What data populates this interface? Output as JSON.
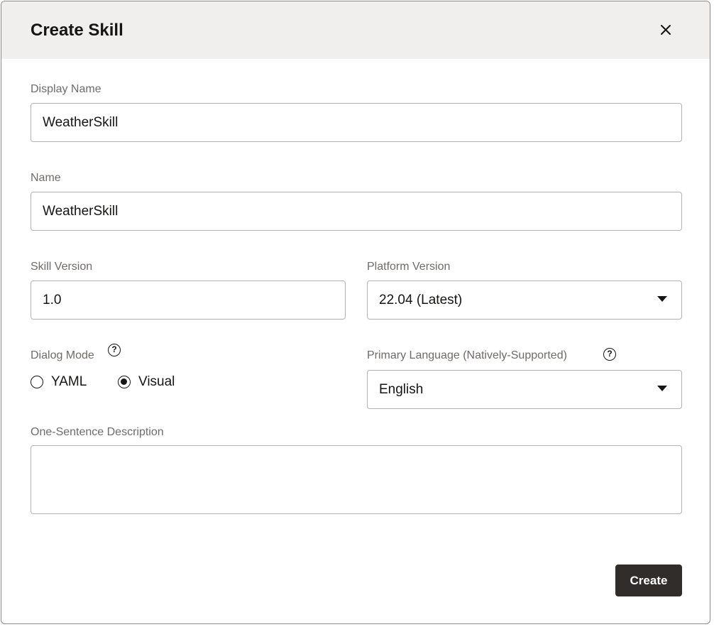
{
  "dialog": {
    "title": "Create Skill",
    "close_icon": "close-icon"
  },
  "form": {
    "display_name": {
      "label": "Display Name",
      "value": "WeatherSkill"
    },
    "name": {
      "label": "Name",
      "value": "WeatherSkill"
    },
    "skill_version": {
      "label": "Skill Version",
      "value": "1.0"
    },
    "platform_version": {
      "label": "Platform Version",
      "selected": "22.04 (Latest)",
      "icon": "chevron-down-icon"
    },
    "dialog_mode": {
      "label": "Dialog Mode",
      "help_icon": "help-icon",
      "options": [
        {
          "label": "YAML",
          "checked": false
        },
        {
          "label": "Visual",
          "checked": true
        }
      ]
    },
    "primary_language": {
      "label": "Primary Language (Natively-Supported)",
      "help_icon": "help-icon",
      "selected": "English",
      "icon": "chevron-down-icon"
    },
    "description": {
      "label": "One-Sentence Description",
      "value": ""
    }
  },
  "footer": {
    "create_label": "Create"
  },
  "colors": {
    "header_bg": "#f1efed",
    "primary_button": "#312d2a",
    "label_text": "#6f6c69",
    "border": "#b5b2ae"
  }
}
